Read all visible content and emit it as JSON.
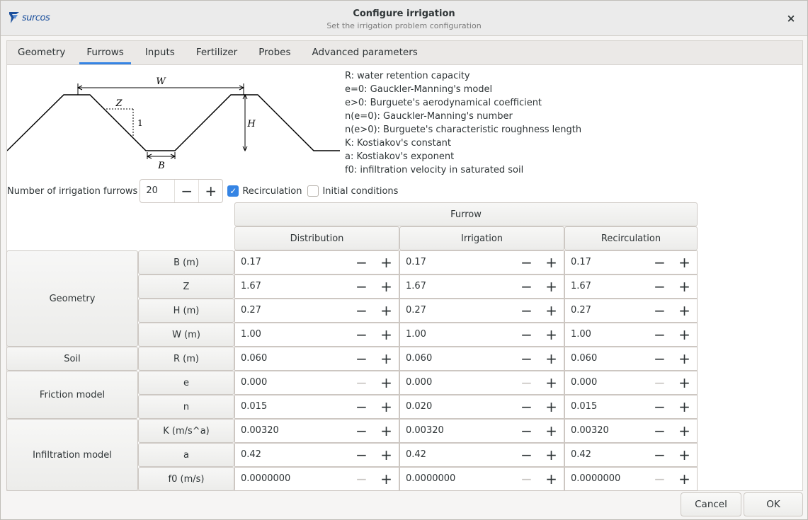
{
  "window": {
    "logo_text": "surcos",
    "title": "Configure irrigation",
    "subtitle": "Set the irrigation problem configuration",
    "close_label": "×"
  },
  "tabs": [
    {
      "label": "Geometry",
      "active": false
    },
    {
      "label": "Furrows",
      "active": true
    },
    {
      "label": "Inputs",
      "active": false
    },
    {
      "label": "Fertilizer",
      "active": false
    },
    {
      "label": "Probes",
      "active": false
    },
    {
      "label": "Advanced parameters",
      "active": false
    }
  ],
  "diagram_labels": {
    "W": "W",
    "Z": "Z",
    "one": "1",
    "H": "H",
    "B": "B"
  },
  "legend": [
    "R: water retention capacity",
    "e=0: Gauckler-Manning's model",
    "e>0: Burguete's aerodynamical coefficient",
    "n(e=0): Gauckler-Manning's number",
    "n(e>0): Burguete's characteristic roughness length",
    "K: Kostiakov's constant",
    "a: Kostiakov's exponent",
    "f0: infiltration velocity in saturated soil"
  ],
  "furrows": {
    "label": "Number of irrigation furrows",
    "value": "20",
    "minus": "−",
    "plus": "+",
    "recirculation_label": "Recirculation",
    "recirculation_checked": true,
    "initial_conditions_label": "Initial conditions",
    "initial_conditions_checked": false,
    "check_mark": "✓"
  },
  "table": {
    "top_header": "Furrow",
    "columns": [
      "Distribution",
      "Irrigation",
      "Recirculation"
    ],
    "groups": [
      "Geometry",
      "Soil",
      "Friction model",
      "Infiltration model"
    ],
    "rows": [
      {
        "label": "B (m)",
        "values": [
          "0.17",
          "0.17",
          "0.17"
        ]
      },
      {
        "label": "Z",
        "values": [
          "1.67",
          "1.67",
          "1.67"
        ]
      },
      {
        "label": "H (m)",
        "values": [
          "0.27",
          "0.27",
          "0.27"
        ]
      },
      {
        "label": "W (m)",
        "values": [
          "1.00",
          "1.00",
          "1.00"
        ]
      },
      {
        "label": "R (m)",
        "values": [
          "0.060",
          "0.060",
          "0.060"
        ]
      },
      {
        "label": "e",
        "values": [
          "0.000",
          "0.000",
          "0.000"
        ]
      },
      {
        "label": "n",
        "values": [
          "0.015",
          "0.020",
          "0.015"
        ]
      },
      {
        "label": "K (m/s^a)",
        "values": [
          "0.00320",
          "0.00320",
          "0.00320"
        ]
      },
      {
        "label": "a",
        "values": [
          "0.42",
          "0.42",
          "0.42"
        ]
      },
      {
        "label": "f0 (m/s)",
        "values": [
          "0.0000000",
          "0.0000000",
          "0.0000000"
        ]
      }
    ],
    "minus_disabled_rows": [
      5,
      9
    ]
  },
  "buttons": {
    "cancel": "Cancel",
    "ok": "OK"
  },
  "colors": {
    "accent": "#3584e4",
    "logo": "#1b4f9c"
  }
}
